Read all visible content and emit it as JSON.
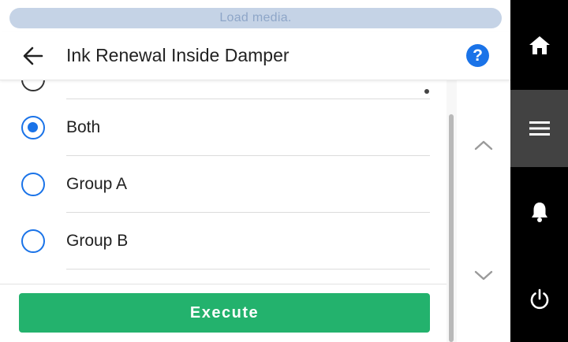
{
  "status": {
    "message": "Load media."
  },
  "header": {
    "title": "Ink Renewal Inside Damper",
    "help_label": "?"
  },
  "options": [
    {
      "label": "Both",
      "selected": true
    },
    {
      "label": "Group A",
      "selected": false
    },
    {
      "label": "Group B",
      "selected": false
    }
  ],
  "footer": {
    "execute_label": "Execute"
  },
  "colors": {
    "accent": "#1a73e8",
    "execute": "#23b26d",
    "status_bg": "#c5d3e6",
    "sidebar": "#000000",
    "sidebar_active": "#424242"
  },
  "icons": {
    "back": "arrow-left-icon",
    "help": "help-circle-icon",
    "scroll_up": "chevron-up-icon",
    "scroll_down": "chevron-down-icon",
    "home": "home-icon",
    "menu": "menu-icon",
    "notifications": "bell-icon",
    "power": "power-icon"
  }
}
